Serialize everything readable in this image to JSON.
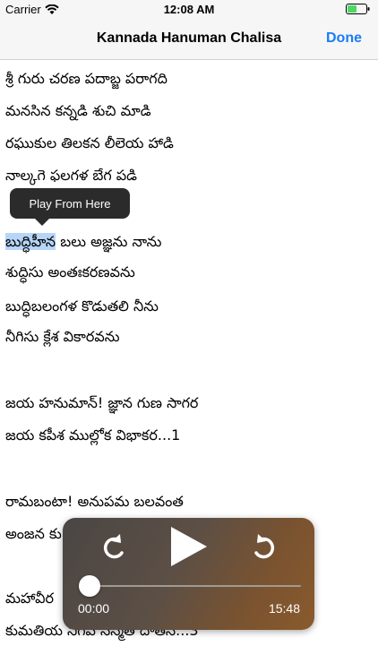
{
  "status_bar": {
    "carrier": "Carrier",
    "time": "12:08 AM"
  },
  "nav": {
    "title": "Kannada Hanuman Chalisa",
    "done_label": "Done"
  },
  "lyrics": {
    "l1": "శ్రీ గురు చరణ పదాబ్జ పరాగది",
    "l2": "మనసిన కన్నడి శుచి మాడి",
    "l3": "రఘుకుల తిలకన లీలెయ హాడి",
    "l4": "నాల్కగె ఫలగళ బేగ పడి",
    "l5_highlight": "బుద్ధిహీన",
    "l5_rest": " బలు అజ్ఞను నాను",
    "l6": "శుద్ధిసు అంతఃకరణవను",
    "l7": "బుద్ధిబలంగళ కొడుతలి నీను",
    "l8": "నీగిసు క్లేశ వికారవను",
    "l9": "జయ హనుమాన్! జ్ఞాన గుణ సాగర",
    "l10": "జయ కపీశ ముల్లోక విభాకర...1",
    "l11": "రామబంటా! అనుపమ బలవంత",
    "l12": "అంజన కు",
    "l13": "మహావీర",
    "l14": "కుమతియ నిగిప సన్మతి దాతనే...3"
  },
  "tooltip": {
    "label": "Play From Here"
  },
  "player": {
    "elapsed": "00:00",
    "remaining": "15:48",
    "progress_fraction": 0.0
  },
  "colors": {
    "accent": "#1a7cf5",
    "highlight": "#b6d5f7"
  },
  "icons": [
    "wifi-icon",
    "battery-icon",
    "rewind-icon",
    "play-icon",
    "forward-icon"
  ]
}
